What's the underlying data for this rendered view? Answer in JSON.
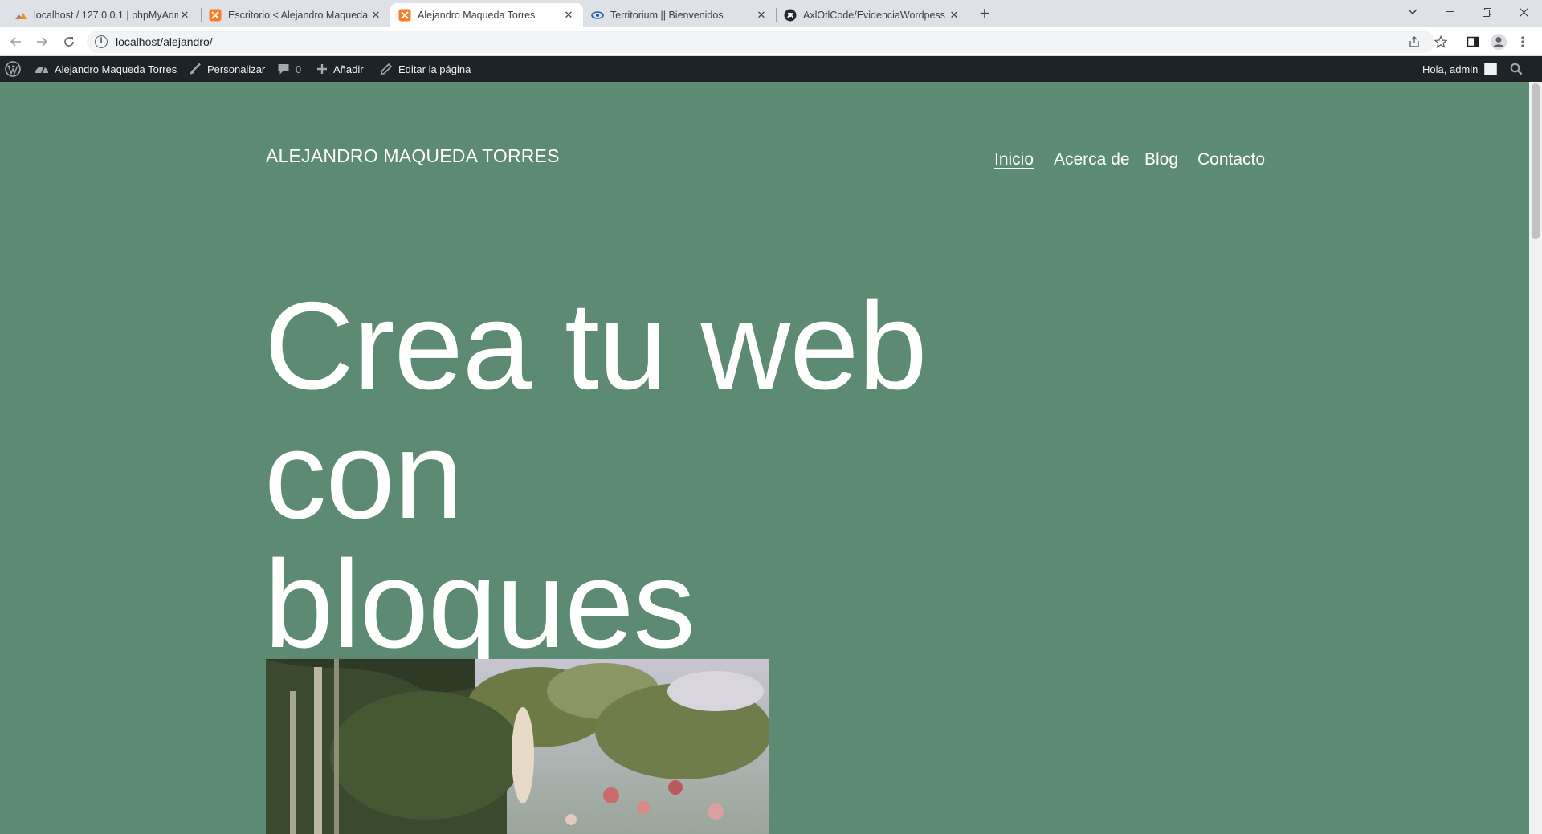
{
  "browser": {
    "tabs": [
      {
        "title": "localhost / 127.0.0.1 | phpMyAdmin",
        "favicon": "phpmyadmin-icon",
        "active": false
      },
      {
        "title": "Escritorio < Alejandro Maqueda Torres",
        "favicon": "xampp-icon",
        "active": false
      },
      {
        "title": "Alejandro Maqueda Torres",
        "favicon": "xampp-icon",
        "active": true
      },
      {
        "title": "Territorium || Bienvenidos",
        "favicon": "territorium-eye-icon",
        "active": false
      },
      {
        "title": "AxlOtlCode/EvidenciaWordpess",
        "favicon": "github-icon",
        "active": false
      }
    ],
    "address": {
      "url": "localhost/alejandro/"
    }
  },
  "adminbar": {
    "site_name": "Alejandro Maqueda Torres",
    "customize": "Personalizar",
    "comments_count": "0",
    "new": "Añadir",
    "edit_page": "Editar la página",
    "greeting": "Hola, admin"
  },
  "site": {
    "title": "ALEJANDRO MAQUEDA TORRES",
    "nav": [
      {
        "label": "Inicio",
        "current": true
      },
      {
        "label": "Acerca de",
        "current": false
      },
      {
        "label": "Blog",
        "current": false
      },
      {
        "label": "Contacto",
        "current": false
      }
    ],
    "hero_line1": "Crea tu web con",
    "hero_line2": "bloques"
  },
  "colors": {
    "page_background": "#5c8a73",
    "adminbar_background": "#1d2327",
    "tabstrip_background": "#dee1e6",
    "text": "#ffffff"
  }
}
